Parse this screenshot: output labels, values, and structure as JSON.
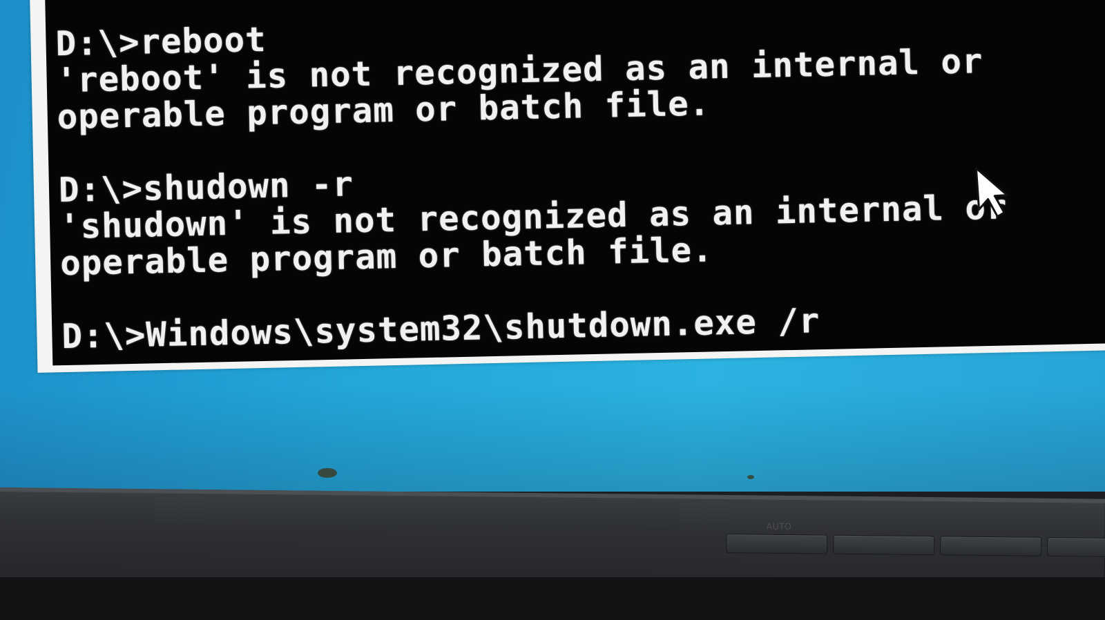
{
  "console": {
    "lines": [
      "D:\\>reboot",
      "'reboot' is not recognized as an internal or",
      "operable program or batch file.",
      "",
      "D:\\>shudown -r",
      "'shudown' is not recognized as an internal or",
      "operable program or batch file.",
      "",
      "D:\\>Windows\\system32\\shutdown.exe /r"
    ]
  },
  "cursor": {
    "icon": "mouse-pointer-icon"
  },
  "monitor": {
    "button_label_auto": "AUTO"
  },
  "colors": {
    "console_background": "#050505",
    "console_text": "#f1f1f1",
    "desktop_blue": "#23a6d8",
    "bezel": "#2e3034"
  }
}
